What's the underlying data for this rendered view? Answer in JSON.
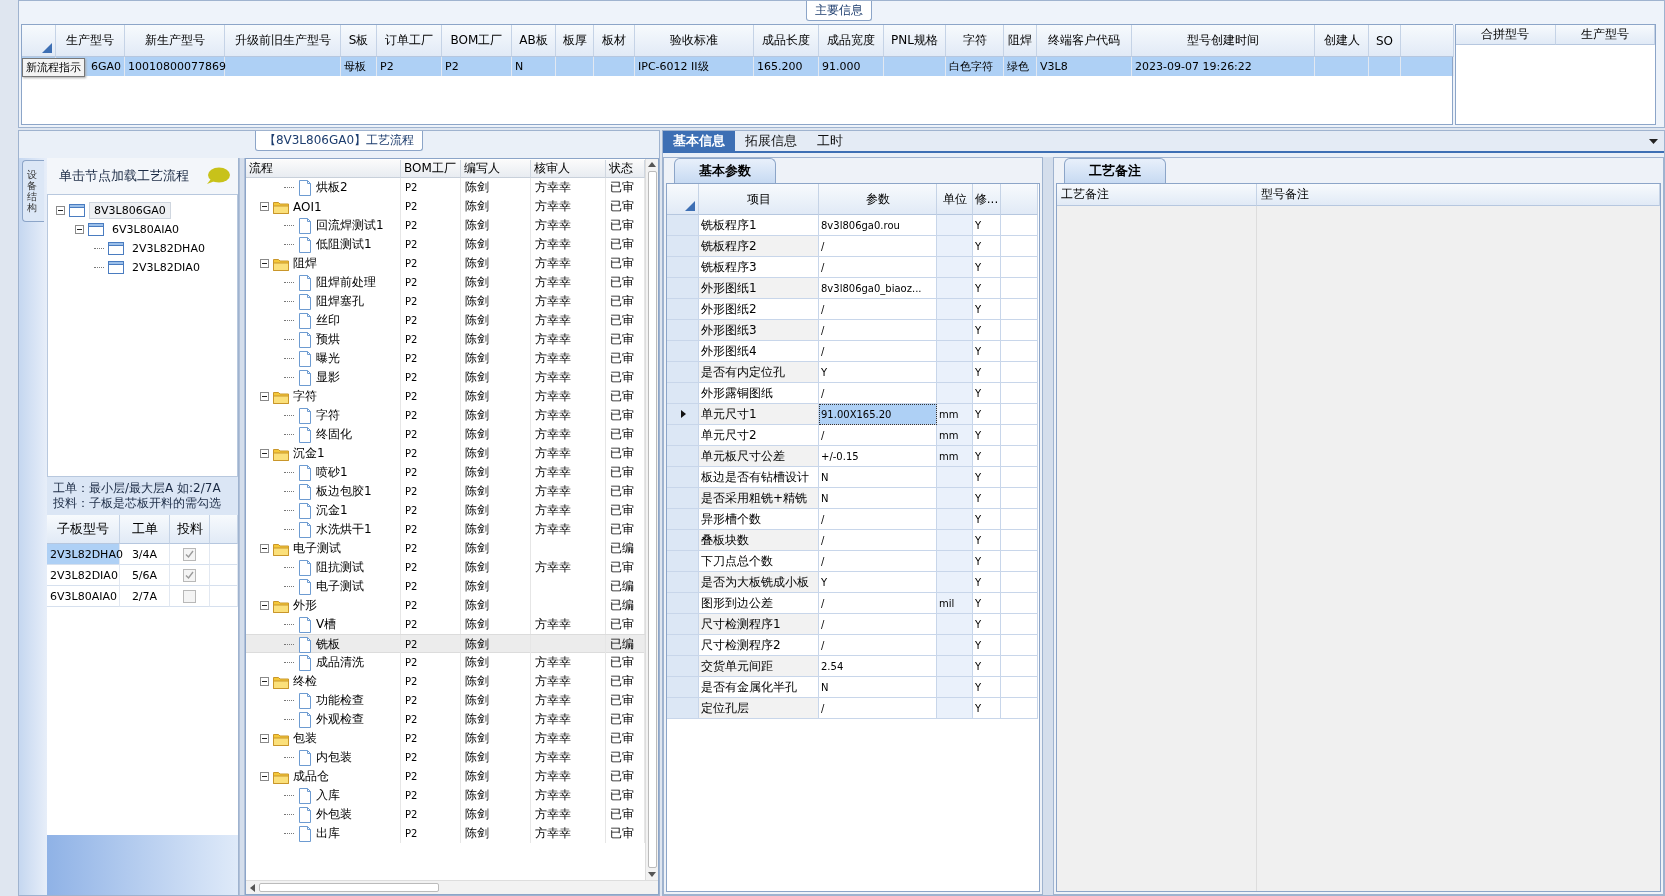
{
  "main_info": {
    "title": "主要信息",
    "tooltip": "新流程指示",
    "columns": [
      "生产型号",
      "新生产型号",
      "升级前旧生产型号",
      "S板",
      "订单工厂",
      "BOM工厂",
      "AB板",
      "板厚",
      "板材",
      "验收标准",
      "成品长度",
      "成品宽度",
      "PNL规格",
      "字符",
      "阻焊",
      "终端客户代码",
      "型号创建时间",
      "创建人",
      "SO"
    ],
    "rows": [
      {
        "selected": true,
        "cells": [
          "6GA0",
          "10010800077869",
          "",
          "母板",
          "P2",
          "P2",
          "N",
          "",
          "",
          "IPC-6012 II级",
          "165.200",
          "91.000",
          "",
          "白色字符",
          "绿色",
          "V3L8",
          "2023-09-07 19:26:22",
          "",
          ""
        ]
      }
    ]
  },
  "merge_panel": {
    "columns": [
      "合拼型号",
      "生产型号"
    ]
  },
  "flow_panel": {
    "title": "【8V3L806GA0】工艺流程",
    "side_tab": "设备结构",
    "hint": "单击节点加载工艺流程",
    "structure_tree": [
      {
        "label": "8V3L806GA0",
        "selected": true,
        "expanded": true,
        "children": [
          {
            "label": "6V3L80AIA0",
            "selected": false,
            "expanded": true,
            "children": [
              {
                "label": "2V3L82DHA0",
                "selected": false
              },
              {
                "label": "2V3L82DIA0",
                "selected": false
              }
            ]
          }
        ]
      }
    ],
    "notes": [
      "工单：最小层/最大层A 如:2/7A",
      "投料：子板是芯板开料的需勾选"
    ],
    "sub_boards": {
      "columns": [
        "子板型号",
        "工单",
        "投料"
      ],
      "rows": [
        {
          "model": "2V3L82DHA0",
          "order": "3/4A",
          "checked": true,
          "selected": true
        },
        {
          "model": "2V3L82DIA0",
          "order": "5/6A",
          "checked": true,
          "selected": false
        },
        {
          "model": "6V3L80AIA0",
          "order": "2/7A",
          "checked": false,
          "selected": false
        }
      ]
    }
  },
  "flow_tree": {
    "columns": [
      "流程",
      "BOM工厂",
      "编写人",
      "核审人",
      "状态"
    ],
    "nodes": [
      {
        "children": [
          {
            "kind": "step",
            "name": "烘板2",
            "bom": "P2",
            "writer": "陈剑",
            "reviewer": "方幸幸",
            "status": "已审",
            "selected": false
          }
        ]
      },
      {
        "kind": "folder",
        "name": "AOI1",
        "bom": "P2",
        "writer": "陈剑",
        "reviewer": "方幸幸",
        "status": "已审",
        "selected": false,
        "expanded": true,
        "children": [
          {
            "kind": "step",
            "name": "回流焊测试1",
            "bom": "P2",
            "writer": "陈剑",
            "reviewer": "方幸幸",
            "status": "已审",
            "selected": false
          },
          {
            "kind": "step",
            "name": "低阻测试1",
            "bom": "P2",
            "writer": "陈剑",
            "reviewer": "方幸幸",
            "status": "已审",
            "selected": false
          }
        ]
      },
      {
        "kind": "folder",
        "name": "阻焊",
        "bom": "P2",
        "writer": "陈剑",
        "reviewer": "方幸幸",
        "status": "已审",
        "selected": false,
        "expanded": true,
        "children": [
          {
            "kind": "step",
            "name": "阻焊前处理",
            "bom": "P2",
            "writer": "陈剑",
            "reviewer": "方幸幸",
            "status": "已审",
            "selected": false
          },
          {
            "kind": "step",
            "name": "阻焊塞孔",
            "bom": "P2",
            "writer": "陈剑",
            "reviewer": "方幸幸",
            "status": "已审",
            "selected": false
          },
          {
            "kind": "step",
            "name": "丝印",
            "bom": "P2",
            "writer": "陈剑",
            "reviewer": "方幸幸",
            "status": "已审",
            "selected": false
          },
          {
            "kind": "step",
            "name": "预烘",
            "bom": "P2",
            "writer": "陈剑",
            "reviewer": "方幸幸",
            "status": "已审",
            "selected": false
          },
          {
            "kind": "step",
            "name": "曝光",
            "bom": "P2",
            "writer": "陈剑",
            "reviewer": "方幸幸",
            "status": "已审",
            "selected": false
          },
          {
            "kind": "step",
            "name": "显影",
            "bom": "P2",
            "writer": "陈剑",
            "reviewer": "方幸幸",
            "status": "已审",
            "selected": false
          }
        ]
      },
      {
        "kind": "folder",
        "name": "字符",
        "bom": "P2",
        "writer": "陈剑",
        "reviewer": "方幸幸",
        "status": "已审",
        "selected": false,
        "expanded": true,
        "children": [
          {
            "kind": "step",
            "name": "字符",
            "bom": "P2",
            "writer": "陈剑",
            "reviewer": "方幸幸",
            "status": "已审",
            "selected": false
          },
          {
            "kind": "step",
            "name": "终固化",
            "bom": "P2",
            "writer": "陈剑",
            "reviewer": "方幸幸",
            "status": "已审",
            "selected": false
          }
        ]
      },
      {
        "kind": "folder",
        "name": "沉金1",
        "bom": "P2",
        "writer": "陈剑",
        "reviewer": "方幸幸",
        "status": "已审",
        "selected": false,
        "expanded": true,
        "children": [
          {
            "kind": "step",
            "name": "喷砂1",
            "bom": "P2",
            "writer": "陈剑",
            "reviewer": "方幸幸",
            "status": "已审",
            "selected": false
          },
          {
            "kind": "step",
            "name": "板边包胶1",
            "bom": "P2",
            "writer": "陈剑",
            "reviewer": "方幸幸",
            "status": "已审",
            "selected": false
          },
          {
            "kind": "step",
            "name": "沉金1",
            "bom": "P2",
            "writer": "陈剑",
            "reviewer": "方幸幸",
            "status": "已审",
            "selected": false
          },
          {
            "kind": "step",
            "name": "水洗烘干1",
            "bom": "P2",
            "writer": "陈剑",
            "reviewer": "方幸幸",
            "status": "已审",
            "selected": false
          }
        ]
      },
      {
        "kind": "folder",
        "name": "电子测试",
        "bom": "P2",
        "writer": "陈剑",
        "status": "已编",
        "selected": false,
        "expanded": true,
        "children": [
          {
            "kind": "step",
            "name": "阻抗测试",
            "bom": "P2",
            "writer": "陈剑",
            "reviewer": "方幸幸",
            "status": "已审",
            "selected": false
          },
          {
            "kind": "step",
            "name": "电子测试",
            "bom": "P2",
            "writer": "陈剑",
            "status": "已编",
            "selected": false
          }
        ]
      },
      {
        "kind": "folder",
        "name": "外形",
        "bom": "P2",
        "writer": "陈剑",
        "status": "已编",
        "selected": false,
        "expanded": true,
        "children": [
          {
            "kind": "step",
            "name": "V槽",
            "bom": "P2",
            "writer": "陈剑",
            "reviewer": "方幸幸",
            "status": "已审",
            "selected": false
          },
          {
            "kind": "step",
            "name": "铣板",
            "bom": "P2",
            "writer": "陈剑",
            "status": "已编",
            "selected": true
          },
          {
            "kind": "step",
            "name": "成品清洗",
            "bom": "P2",
            "writer": "陈剑",
            "reviewer": "方幸幸",
            "status": "已审",
            "selected": false
          }
        ]
      },
      {
        "kind": "folder",
        "name": "终检",
        "bom": "P2",
        "writer": "陈剑",
        "reviewer": "方幸幸",
        "status": "已审",
        "selected": false,
        "expanded": true,
        "children": [
          {
            "kind": "step",
            "name": "功能检查",
            "bom": "P2",
            "writer": "陈剑",
            "reviewer": "方幸幸",
            "status": "已审",
            "selected": false
          },
          {
            "kind": "step",
            "name": "外观检查",
            "bom": "P2",
            "writer": "陈剑",
            "reviewer": "方幸幸",
            "status": "已审",
            "selected": false
          }
        ]
      },
      {
        "kind": "folder",
        "name": "包装",
        "bom": "P2",
        "writer": "陈剑",
        "reviewer": "方幸幸",
        "status": "已审",
        "selected": false,
        "expanded": true,
        "children": [
          {
            "kind": "step",
            "name": "内包装",
            "bom": "P2",
            "writer": "陈剑",
            "reviewer": "方幸幸",
            "status": "已审",
            "selected": false
          }
        ]
      },
      {
        "kind": "folder",
        "name": "成品仓",
        "bom": "P2",
        "writer": "陈剑",
        "reviewer": "方幸幸",
        "status": "已审",
        "selected": false,
        "expanded": true,
        "children": [
          {
            "kind": "step",
            "name": "入库",
            "bom": "P2",
            "writer": "陈剑",
            "reviewer": "方幸幸",
            "status": "已审",
            "selected": false
          },
          {
            "kind": "step",
            "name": "外包装",
            "bom": "P2",
            "writer": "陈剑",
            "reviewer": "方幸幸",
            "status": "已审",
            "selected": false
          },
          {
            "kind": "step",
            "name": "出库",
            "bom": "P2",
            "writer": "陈剑",
            "reviewer": "方幸幸",
            "status": "已审",
            "selected": false
          }
        ]
      }
    ]
  },
  "detail": {
    "tabs": [
      {
        "label": "基本信息",
        "selected": true
      },
      {
        "label": "拓展信息",
        "selected": false
      },
      {
        "label": "工时",
        "selected": false
      }
    ],
    "basic_params": {
      "title": "基本参数",
      "columns": [
        "项目",
        "参数",
        "单位",
        "修..."
      ],
      "rows": [
        {
          "item": "铣板程序1",
          "value": "8v3l806ga0.rou",
          "modified": "Y",
          "selected": false
        },
        {
          "item": "铣板程序2",
          "value": "/",
          "modified": "Y",
          "selected": false
        },
        {
          "item": "铣板程序3",
          "value": "/",
          "modified": "Y",
          "selected": false
        },
        {
          "item": "外形图纸1",
          "value": "8v3l806ga0_biaoz...",
          "modified": "Y",
          "selected": false
        },
        {
          "item": "外形图纸2",
          "value": "/",
          "modified": "Y",
          "selected": false
        },
        {
          "item": "外形图纸3",
          "value": "/",
          "modified": "Y",
          "selected": false
        },
        {
          "item": "外形图纸4",
          "value": "/",
          "modified": "Y",
          "selected": false
        },
        {
          "item": "是否有内定位孔",
          "value": "Y",
          "modified": "Y",
          "selected": false
        },
        {
          "item": "外形露铜图纸",
          "value": "/",
          "modified": "Y",
          "selected": false
        },
        {
          "item": "单元尺寸1",
          "value": "91.00X165.20",
          "unit": "mm",
          "modified": "Y",
          "selected": true
        },
        {
          "item": "单元尺寸2",
          "value": "/",
          "unit": "mm",
          "modified": "Y",
          "selected": false
        },
        {
          "item": "单元板尺寸公差",
          "value": "+/-0.15",
          "unit": "mm",
          "modified": "Y",
          "selected": false
        },
        {
          "item": "板边是否有钻槽设计",
          "value": "N",
          "modified": "Y",
          "selected": false
        },
        {
          "item": "是否采用粗铣+精铣",
          "value": "N",
          "modified": "Y",
          "selected": false
        },
        {
          "item": "异形槽个数",
          "value": "/",
          "modified": "Y",
          "selected": false
        },
        {
          "item": "叠板块数",
          "value": "/",
          "modified": "Y",
          "selected": false
        },
        {
          "item": "下刀点总个数",
          "value": "/",
          "modified": "Y",
          "selected": false
        },
        {
          "item": "是否为大板铣成小板",
          "value": "Y",
          "modified": "Y",
          "selected": false
        },
        {
          "item": "图形到边公差",
          "value": "/",
          "unit": "mil",
          "modified": "Y",
          "selected": false
        },
        {
          "item": "尺寸检测程序1",
          "value": "/",
          "modified": "Y",
          "selected": false
        },
        {
          "item": "尺寸检测程序2",
          "value": "/",
          "modified": "Y",
          "selected": false
        },
        {
          "item": "交货单元间距",
          "value": "2.54",
          "modified": "Y",
          "selected": false
        },
        {
          "item": "是否有金属化半孔",
          "value": "N",
          "modified": "Y",
          "selected": false
        },
        {
          "item": "定位孔层",
          "value": "/",
          "modified": "Y",
          "selected": false
        }
      ]
    },
    "remarks": {
      "title": "工艺备注",
      "columns": [
        "工艺备注",
        "型号备注"
      ]
    }
  }
}
